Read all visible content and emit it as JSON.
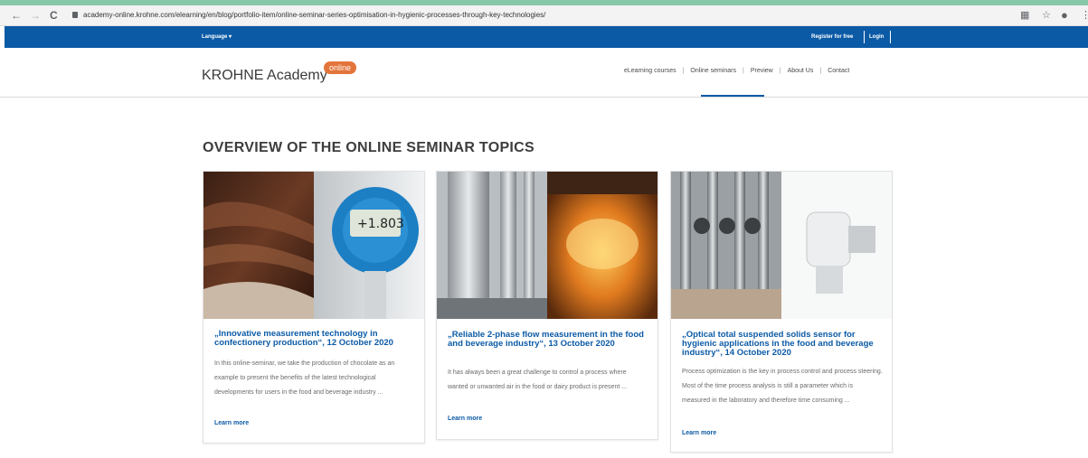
{
  "browser": {
    "url": "academy-online.krohne.com/elearning/en/blog/portfolio-item/online-seminar-series-optimisation-in-hygienic-processes-through-key-technologies/",
    "back_icon": "←",
    "forward_icon": "→",
    "reload_icon": "C"
  },
  "topbar": {
    "language": "Language ▾",
    "register": "Register for free",
    "login": "Login"
  },
  "header": {
    "logo": "KROHNE Academy",
    "logo_badge": "online",
    "menu": [
      "eLearning courses",
      "Online seminars",
      "Preview",
      "About Us",
      "Contact"
    ]
  },
  "page": {
    "section_title": "OVERVIEW OF THE ONLINE SEMINAR TOPICS"
  },
  "cards": [
    {
      "title": "„Innovative measurement technology in confectionery production“, 12 October 2020",
      "desc": "In this online-seminar, we take the production of chocolate as an example to present the benefits of the latest technological developments for users in the food and beverage industry ...",
      "more": "Learn more",
      "display": "+1.803"
    },
    {
      "title": "„Reliable 2-phase flow measurement in the food and beverage industry“, 13 October 2020",
      "desc": "It has always been a great challenge to control a process where wanted or unwanted air in the food or dairy product is present ...",
      "more": "Learn more"
    },
    {
      "title": "„Optical total suspended solids sensor for hygienic applications in the food and beverage industry“, 14 October 2020",
      "desc": "Process optimization is the key in process control and process steering. Most of the time process analysis is still a parameter which is measured in the laboratory and therefore time consuming ...",
      "more": "Learn more"
    }
  ]
}
